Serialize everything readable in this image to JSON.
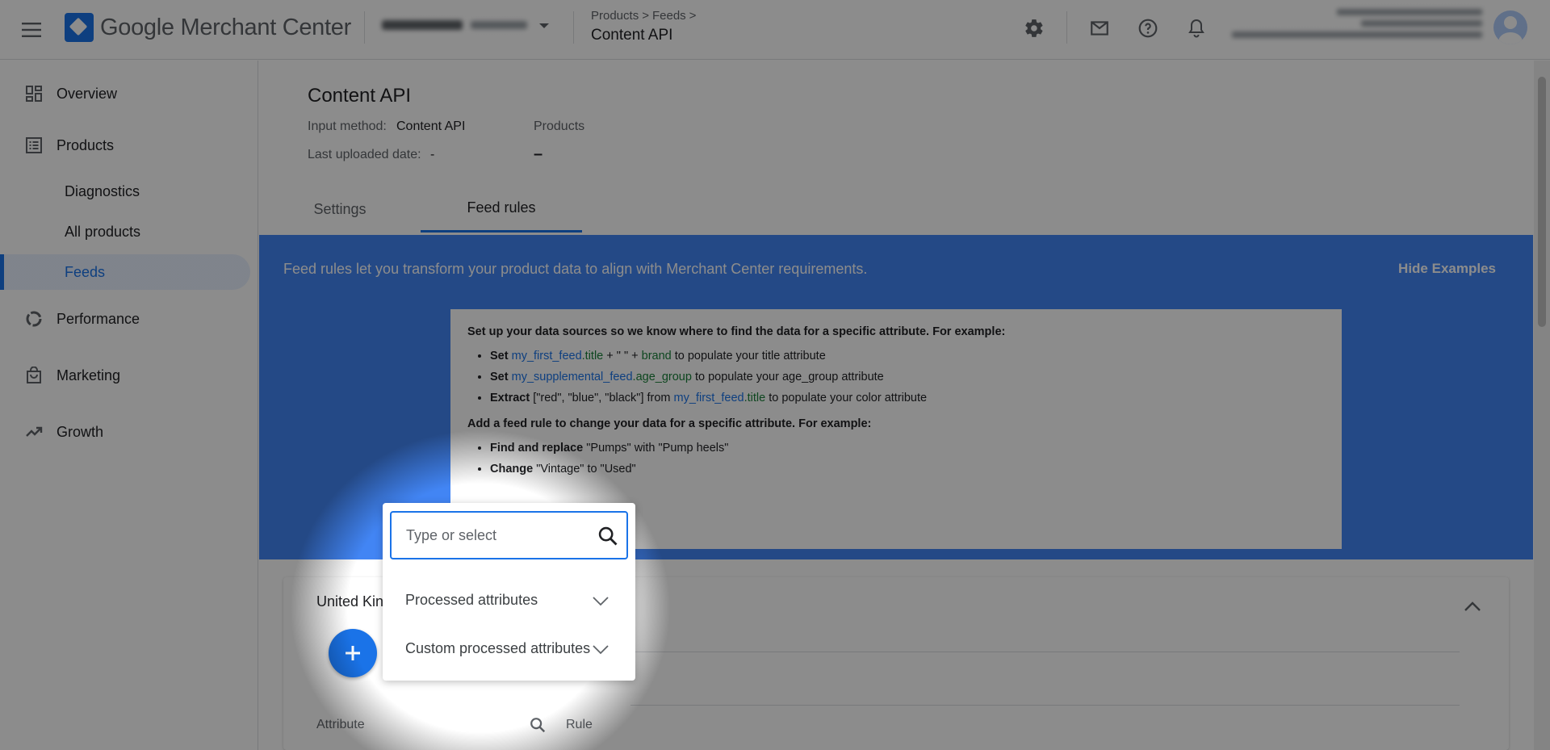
{
  "header": {
    "app_title": "Google Merchant Center",
    "breadcrumb": [
      "Products",
      ">",
      "Feeds",
      ">"
    ],
    "page_title": "Content API"
  },
  "sidebar": {
    "items": [
      {
        "label": "Overview",
        "icon": "dashboard-icon"
      },
      {
        "label": "Products",
        "icon": "list-icon"
      },
      {
        "label": "Diagnostics"
      },
      {
        "label": "All products"
      },
      {
        "label": "Feeds",
        "active": true
      },
      {
        "label": "Performance",
        "icon": "donut-chart-icon"
      },
      {
        "label": "Marketing",
        "icon": "shopping-bag-icon"
      },
      {
        "label": "Growth",
        "icon": "trending-up-icon"
      }
    ]
  },
  "feed": {
    "title": "Content API",
    "input_method_label": "Input method:",
    "input_method_value": "Content API",
    "products_label": "Products",
    "products_value": "–",
    "last_uploaded_label": "Last uploaded date:",
    "last_uploaded_value": "-"
  },
  "tabs": [
    {
      "label": "Settings"
    },
    {
      "label": "Feed rules",
      "active": true
    }
  ],
  "banner": {
    "text": "Feed rules let you transform your product data to align with Merchant Center requirements.",
    "hide_label": "Hide Examples",
    "section1_heading": "Set up your data sources so we know where to find the data for a specific attribute. For example:",
    "ex1": {
      "verb": "Set",
      "a": "my_first_feed",
      "b": ".title",
      "mid": " + \" \" + ",
      "c": "brand",
      "tail": " to populate your title attribute"
    },
    "ex2": {
      "verb": "Set",
      "a": "my_supplemental_feed",
      "b": ".age_group",
      "tail": " to populate your age_group attribute"
    },
    "ex3": {
      "verb": "Extract",
      "pre": " [\"red\", \"blue\", \"black\"] from ",
      "a": "my_first_feed",
      "b": ".title",
      "tail": " to populate your color attribute"
    },
    "section2_heading": "Add a feed rule to change your data for a specific attribute. For example:",
    "ex4": {
      "verb": "Find and replace",
      "tail": " \"Pumps\" with \"Pump heels\""
    },
    "ex5": {
      "verb": "Change",
      "tail": " \"Vintage\" to \"Used\""
    }
  },
  "card": {
    "title": "United Kin",
    "col_attribute": "Attribute",
    "col_rule": "Rule"
  },
  "popup": {
    "search_placeholder": "Type or select",
    "options": [
      "Processed attributes",
      "Custom processed attributes"
    ]
  },
  "colors": {
    "accent": "#1a73e8",
    "banner": "#4285f4",
    "link_green": "#188038"
  }
}
